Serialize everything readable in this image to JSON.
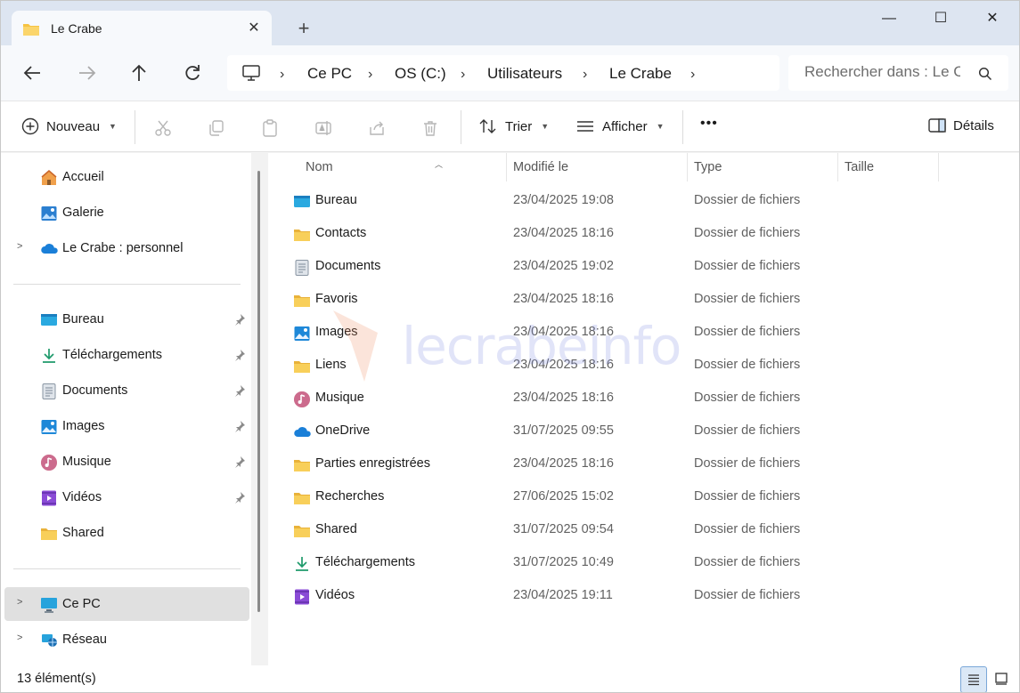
{
  "tab": {
    "title": "Le Crabe",
    "close": "✕",
    "new_tab": "+"
  },
  "window_controls": {
    "minimize": "—",
    "maximize": "☐",
    "close": "✕"
  },
  "breadcrumb": [
    "Ce PC",
    "OS (C:)",
    "Utilisateurs",
    "Le Crabe"
  ],
  "breadcrumb_separator": "›",
  "search": {
    "placeholder": "Rechercher dans : Le C"
  },
  "toolbar": {
    "new_label": "Nouveau",
    "sort_label": "Trier",
    "view_label": "Afficher",
    "more_label": "•••",
    "details_label": "Détails"
  },
  "sidebar": {
    "top": [
      {
        "label": "Accueil",
        "icon": "home-icon"
      },
      {
        "label": "Galerie",
        "icon": "gallery-icon"
      },
      {
        "label": "Le Crabe : personnel",
        "icon": "onedrive-icon",
        "expandable": true
      }
    ],
    "quick": [
      {
        "label": "Bureau",
        "icon": "desktop-icon",
        "pinned": true
      },
      {
        "label": "Téléchargements",
        "icon": "download-icon",
        "pinned": true
      },
      {
        "label": "Documents",
        "icon": "documents-icon",
        "pinned": true
      },
      {
        "label": "Images",
        "icon": "images-icon",
        "pinned": true
      },
      {
        "label": "Musique",
        "icon": "music-icon",
        "pinned": true
      },
      {
        "label": "Vidéos",
        "icon": "videos-icon",
        "pinned": true
      },
      {
        "label": "Shared",
        "icon": "folder-icon",
        "pinned": false
      }
    ],
    "bottom": [
      {
        "label": "Ce PC",
        "icon": "pc-icon",
        "selected": true
      },
      {
        "label": "Réseau",
        "icon": "network-icon",
        "selected": false
      }
    ]
  },
  "columns": {
    "name": "Nom",
    "modified": "Modifié le",
    "type": "Type",
    "size": "Taille"
  },
  "files": [
    {
      "name": "Bureau",
      "modified": "23/04/2025 19:08",
      "type": "Dossier de fichiers",
      "icon": "desktop-icon"
    },
    {
      "name": "Contacts",
      "modified": "23/04/2025 18:16",
      "type": "Dossier de fichiers",
      "icon": "folder-icon"
    },
    {
      "name": "Documents",
      "modified": "23/04/2025 19:02",
      "type": "Dossier de fichiers",
      "icon": "documents-icon"
    },
    {
      "name": "Favoris",
      "modified": "23/04/2025 18:16",
      "type": "Dossier de fichiers",
      "icon": "folder-icon"
    },
    {
      "name": "Images",
      "modified": "23/04/2025 18:16",
      "type": "Dossier de fichiers",
      "icon": "images-icon"
    },
    {
      "name": "Liens",
      "modified": "23/04/2025 18:16",
      "type": "Dossier de fichiers",
      "icon": "folder-icon"
    },
    {
      "name": "Musique",
      "modified": "23/04/2025 18:16",
      "type": "Dossier de fichiers",
      "icon": "music-icon"
    },
    {
      "name": "OneDrive",
      "modified": "31/07/2025 09:55",
      "type": "Dossier de fichiers",
      "icon": "onedrive-icon"
    },
    {
      "name": "Parties enregistrées",
      "modified": "23/04/2025 18:16",
      "type": "Dossier de fichiers",
      "icon": "folder-icon"
    },
    {
      "name": "Recherches",
      "modified": "27/06/2025 15:02",
      "type": "Dossier de fichiers",
      "icon": "folder-icon"
    },
    {
      "name": "Shared",
      "modified": "31/07/2025 09:54",
      "type": "Dossier de fichiers",
      "icon": "folder-icon"
    },
    {
      "name": "Téléchargements",
      "modified": "31/07/2025 10:49",
      "type": "Dossier de fichiers",
      "icon": "download-icon"
    },
    {
      "name": "Vidéos",
      "modified": "23/04/2025 19:11",
      "type": "Dossier de fichiers",
      "icon": "videos-icon"
    }
  ],
  "status": {
    "count": "13 élément(s)"
  },
  "watermark": "lecrabeinfo",
  "colors": {
    "accent": "#0067c0",
    "folder": "#f6c343",
    "selected_bg": "#e0e0e0"
  }
}
